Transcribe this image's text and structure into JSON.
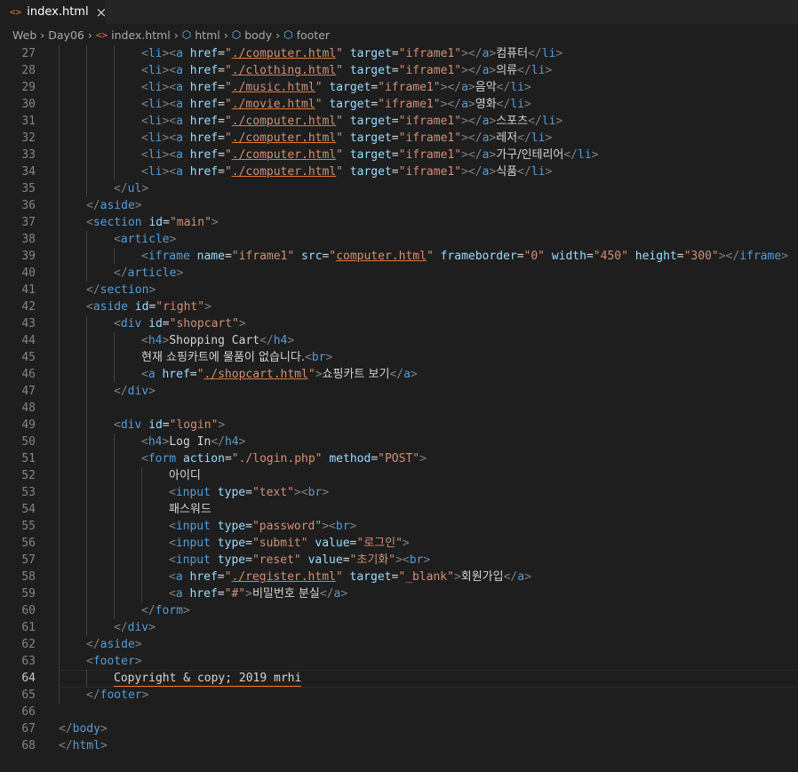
{
  "tab": {
    "label": "index.html",
    "icon": "html-file-icon"
  },
  "breadcrumb": {
    "items": [
      "Web",
      "Day06",
      "index.html",
      "html",
      "body",
      "footer"
    ]
  },
  "colors": {
    "tag": "#569cd6",
    "punct": "#808080",
    "attr": "#9cdcfe",
    "string": "#ce9178",
    "text": "#d4d4d4",
    "link_underline": "#e37933"
  },
  "code_lines": [
    {
      "n": "27",
      "indent": 3,
      "html": "<span class=\"p\">&lt;</span><span class=\"t\">li</span><span class=\"p\">&gt;&lt;</span><span class=\"t\">a</span> <span class=\"a\">href</span>=<span class=\"s\">\"<span class=\"u\">./computer.html</span>\"</span> <span class=\"a\">target</span>=<span class=\"s\">\"iframe1\"</span><span class=\"p\">&gt;&lt;/</span><span class=\"t\">a</span><span class=\"p\">&gt;</span><span class=\"ko\">컴퓨터</span><span class=\"p\">&lt;/</span><span class=\"t\">li</span><span class=\"p\">&gt;</span>"
    },
    {
      "n": "28",
      "indent": 3,
      "html": "<span class=\"p\">&lt;</span><span class=\"t\">li</span><span class=\"p\">&gt;&lt;</span><span class=\"t\">a</span> <span class=\"a\">href</span>=<span class=\"s\">\"<span class=\"u\">./clothing.html</span>\"</span> <span class=\"a\">target</span>=<span class=\"s\">\"iframe1\"</span><span class=\"p\">&gt;&lt;/</span><span class=\"t\">a</span><span class=\"p\">&gt;</span><span class=\"ko\">의류</span><span class=\"p\">&lt;/</span><span class=\"t\">li</span><span class=\"p\">&gt;</span>"
    },
    {
      "n": "29",
      "indent": 3,
      "html": "<span class=\"p\">&lt;</span><span class=\"t\">li</span><span class=\"p\">&gt;&lt;</span><span class=\"t\">a</span> <span class=\"a\">href</span>=<span class=\"s\">\"<span class=\"u\">./music.html</span>\"</span> <span class=\"a\">target</span>=<span class=\"s\">\"iframe1\"</span><span class=\"p\">&gt;&lt;/</span><span class=\"t\">a</span><span class=\"p\">&gt;</span><span class=\"ko\">음악</span><span class=\"p\">&lt;/</span><span class=\"t\">li</span><span class=\"p\">&gt;</span>"
    },
    {
      "n": "30",
      "indent": 3,
      "html": "<span class=\"p\">&lt;</span><span class=\"t\">li</span><span class=\"p\">&gt;&lt;</span><span class=\"t\">a</span> <span class=\"a\">href</span>=<span class=\"s\">\"<span class=\"u\">./movie.html</span>\"</span> <span class=\"a\">target</span>=<span class=\"s\">\"iframe1\"</span><span class=\"p\">&gt;&lt;/</span><span class=\"t\">a</span><span class=\"p\">&gt;</span><span class=\"ko\">영화</span><span class=\"p\">&lt;/</span><span class=\"t\">li</span><span class=\"p\">&gt;</span>"
    },
    {
      "n": "31",
      "indent": 3,
      "html": "<span class=\"p\">&lt;</span><span class=\"t\">li</span><span class=\"p\">&gt;&lt;</span><span class=\"t\">a</span> <span class=\"a\">href</span>=<span class=\"s\">\"<span class=\"u\">./computer.html</span>\"</span> <span class=\"a\">target</span>=<span class=\"s\">\"iframe1\"</span><span class=\"p\">&gt;&lt;/</span><span class=\"t\">a</span><span class=\"p\">&gt;</span><span class=\"ko\">스포츠</span><span class=\"p\">&lt;/</span><span class=\"t\">li</span><span class=\"p\">&gt;</span>"
    },
    {
      "n": "32",
      "indent": 3,
      "html": "<span class=\"p\">&lt;</span><span class=\"t\">li</span><span class=\"p\">&gt;&lt;</span><span class=\"t\">a</span> <span class=\"a\">href</span>=<span class=\"s\">\"<span class=\"u\">./computer.html</span>\"</span> <span class=\"a\">target</span>=<span class=\"s\">\"iframe1\"</span><span class=\"p\">&gt;&lt;/</span><span class=\"t\">a</span><span class=\"p\">&gt;</span><span class=\"ko\">레저</span><span class=\"p\">&lt;/</span><span class=\"t\">li</span><span class=\"p\">&gt;</span>"
    },
    {
      "n": "33",
      "indent": 3,
      "html": "<span class=\"p\">&lt;</span><span class=\"t\">li</span><span class=\"p\">&gt;&lt;</span><span class=\"t\">a</span> <span class=\"a\">href</span>=<span class=\"s\">\"<span class=\"u\">./computer.html</span>\"</span> <span class=\"a\">target</span>=<span class=\"s\">\"iframe1\"</span><span class=\"p\">&gt;&lt;/</span><span class=\"t\">a</span><span class=\"p\">&gt;</span><span class=\"ko\">가구/인테리어</span><span class=\"p\">&lt;/</span><span class=\"t\">li</span><span class=\"p\">&gt;</span>"
    },
    {
      "n": "34",
      "indent": 3,
      "html": "<span class=\"p\">&lt;</span><span class=\"t\">li</span><span class=\"p\">&gt;&lt;</span><span class=\"t\">a</span> <span class=\"a\">href</span>=<span class=\"s\">\"<span class=\"u\">./computer.html</span>\"</span> <span class=\"a\">target</span>=<span class=\"s\">\"iframe1\"</span><span class=\"p\">&gt;&lt;/</span><span class=\"t\">a</span><span class=\"p\">&gt;</span><span class=\"ko\">식품</span><span class=\"p\">&lt;/</span><span class=\"t\">li</span><span class=\"p\">&gt;</span>"
    },
    {
      "n": "35",
      "indent": 2,
      "html": "<span class=\"p\">&lt;/</span><span class=\"t\">ul</span><span class=\"p\">&gt;</span>"
    },
    {
      "n": "36",
      "indent": 1,
      "html": "<span class=\"p\">&lt;/</span><span class=\"t\">aside</span><span class=\"p\">&gt;</span>"
    },
    {
      "n": "37",
      "indent": 1,
      "html": "<span class=\"p\">&lt;</span><span class=\"t\">section</span> <span class=\"a\">id</span>=<span class=\"s\">\"main\"</span><span class=\"p\">&gt;</span>"
    },
    {
      "n": "38",
      "indent": 2,
      "html": "<span class=\"p\">&lt;</span><span class=\"t\">article</span><span class=\"p\">&gt;</span>"
    },
    {
      "n": "39",
      "indent": 3,
      "html": "<span class=\"p\">&lt;</span><span class=\"t\">iframe</span> <span class=\"a\">name</span>=<span class=\"s\">\"iframe1\"</span> <span class=\"a\">src</span>=<span class=\"s\">\"<span class=\"u\">computer.html</span>\"</span> <span class=\"a\">frameborder</span>=<span class=\"s\">\"0\"</span> <span class=\"a\">width</span>=<span class=\"s\">\"450\"</span> <span class=\"a\">height</span>=<span class=\"s\">\"300\"</span><span class=\"p\">&gt;&lt;/</span><span class=\"t\">iframe</span><span class=\"p\">&gt;</span>"
    },
    {
      "n": "40",
      "indent": 2,
      "html": "<span class=\"p\">&lt;/</span><span class=\"t\">article</span><span class=\"p\">&gt;</span>"
    },
    {
      "n": "41",
      "indent": 1,
      "html": "<span class=\"p\">&lt;/</span><span class=\"t\">section</span><span class=\"p\">&gt;</span>"
    },
    {
      "n": "42",
      "indent": 1,
      "html": "<span class=\"p\">&lt;</span><span class=\"t\">aside</span> <span class=\"a\">id</span>=<span class=\"s\">\"right\"</span><span class=\"p\">&gt;</span>"
    },
    {
      "n": "43",
      "indent": 2,
      "html": "<span class=\"p\">&lt;</span><span class=\"t\">div</span> <span class=\"a\">id</span>=<span class=\"s\">\"shopcart\"</span><span class=\"p\">&gt;</span>"
    },
    {
      "n": "44",
      "indent": 3,
      "html": "<span class=\"p\">&lt;</span><span class=\"t\">h4</span><span class=\"p\">&gt;</span>Shopping Cart<span class=\"p\">&lt;/</span><span class=\"t\">h4</span><span class=\"p\">&gt;</span>"
    },
    {
      "n": "45",
      "indent": 3,
      "html": "<span class=\"ko\">현재 쇼핑카트에 물품이 없습니다.</span><span class=\"p\">&lt;</span><span class=\"t\">br</span><span class=\"p\">&gt;</span>"
    },
    {
      "n": "46",
      "indent": 3,
      "html": "<span class=\"p\">&lt;</span><span class=\"t\">a</span> <span class=\"a\">href</span>=<span class=\"s\">\"<span class=\"u\">./shopcart.html</span>\"</span><span class=\"p\">&gt;</span><span class=\"ko\">쇼핑카트 보기</span><span class=\"p\">&lt;/</span><span class=\"t\">a</span><span class=\"p\">&gt;</span>"
    },
    {
      "n": "47",
      "indent": 2,
      "html": "<span class=\"p\">&lt;/</span><span class=\"t\">div</span><span class=\"p\">&gt;</span>"
    },
    {
      "n": "48",
      "indent": 2,
      "html": ""
    },
    {
      "n": "49",
      "indent": 2,
      "html": "<span class=\"p\">&lt;</span><span class=\"t\">div</span> <span class=\"a\">id</span>=<span class=\"s\">\"login\"</span><span class=\"p\">&gt;</span>"
    },
    {
      "n": "50",
      "indent": 3,
      "html": "<span class=\"p\">&lt;</span><span class=\"t\">h4</span><span class=\"p\">&gt;</span>Log In<span class=\"p\">&lt;/</span><span class=\"t\">h4</span><span class=\"p\">&gt;</span>"
    },
    {
      "n": "51",
      "indent": 3,
      "html": "<span class=\"p\">&lt;</span><span class=\"t\">form</span> <span class=\"a\">action</span>=<span class=\"s\">\"./login.php\"</span> <span class=\"a\">method</span>=<span class=\"s\">\"POST\"</span><span class=\"p\">&gt;</span>"
    },
    {
      "n": "52",
      "indent": 4,
      "html": "<span class=\"ko\">아이디</span>"
    },
    {
      "n": "53",
      "indent": 4,
      "html": "<span class=\"p\">&lt;</span><span class=\"t\">input</span> <span class=\"a\">type</span>=<span class=\"s\">\"text\"</span><span class=\"p\">&gt;&lt;</span><span class=\"t\">br</span><span class=\"p\">&gt;</span>"
    },
    {
      "n": "54",
      "indent": 4,
      "html": "<span class=\"ko\">패스워드</span>"
    },
    {
      "n": "55",
      "indent": 4,
      "html": "<span class=\"p\">&lt;</span><span class=\"t\">input</span> <span class=\"a\">type</span>=<span class=\"s\">\"password\"</span><span class=\"p\">&gt;&lt;</span><span class=\"t\">br</span><span class=\"p\">&gt;</span>"
    },
    {
      "n": "56",
      "indent": 4,
      "html": "<span class=\"p\">&lt;</span><span class=\"t\">input</span> <span class=\"a\">type</span>=<span class=\"s\">\"submit\"</span> <span class=\"a\">value</span>=<span class=\"s\">\"<span class=\"ko\">로그인</span>\"</span><span class=\"p\">&gt;</span>"
    },
    {
      "n": "57",
      "indent": 4,
      "html": "<span class=\"p\">&lt;</span><span class=\"t\">input</span> <span class=\"a\">type</span>=<span class=\"s\">\"reset\"</span> <span class=\"a\">value</span>=<span class=\"s\">\"<span class=\"ko\">초기화</span>\"</span><span class=\"p\">&gt;&lt;</span><span class=\"t\">br</span><span class=\"p\">&gt;</span>"
    },
    {
      "n": "58",
      "indent": 4,
      "html": "<span class=\"p\">&lt;</span><span class=\"t\">a</span> <span class=\"a\">href</span>=<span class=\"s\">\"<span class=\"u\">./register.html</span>\"</span> <span class=\"a\">target</span>=<span class=\"s\">\"_blank\"</span><span class=\"p\">&gt;</span><span class=\"ko\">회원가입</span><span class=\"p\">&lt;/</span><span class=\"t\">a</span><span class=\"p\">&gt;</span>"
    },
    {
      "n": "59",
      "indent": 4,
      "html": "<span class=\"p\">&lt;</span><span class=\"t\">a</span> <span class=\"a\">href</span>=<span class=\"s\">\"#\"</span><span class=\"p\">&gt;</span><span class=\"ko\">비밀번호 분실</span><span class=\"p\">&lt;/</span><span class=\"t\">a</span><span class=\"p\">&gt;</span>"
    },
    {
      "n": "60",
      "indent": 3,
      "html": "<span class=\"p\">&lt;/</span><span class=\"t\">form</span><span class=\"p\">&gt;</span>"
    },
    {
      "n": "61",
      "indent": 2,
      "html": "<span class=\"p\">&lt;/</span><span class=\"t\">div</span><span class=\"p\">&gt;</span>"
    },
    {
      "n": "62",
      "indent": 1,
      "html": "<span class=\"p\">&lt;/</span><span class=\"t\">aside</span><span class=\"p\">&gt;</span>"
    },
    {
      "n": "63",
      "indent": 1,
      "html": "<span class=\"p\">&lt;</span><span class=\"t\">footer</span><span class=\"p\">&gt;</span>"
    },
    {
      "n": "64",
      "indent": 2,
      "current": true,
      "html": "<span class=\"k\" style=\"border-bottom:1px solid #e37933;padding-bottom:1px;\">Copyright &amp; copy; 2019 mrhi</span>"
    },
    {
      "n": "65",
      "indent": 1,
      "html": "<span class=\"p\">&lt;/</span><span class=\"t\">footer</span><span class=\"p\">&gt;</span>"
    },
    {
      "n": "66",
      "indent": 0,
      "html": ""
    },
    {
      "n": "67",
      "indent": 0,
      "html": "<span class=\"p\">&lt;/</span><span class=\"t\">body</span><span class=\"p\">&gt;</span>"
    },
    {
      "n": "68",
      "indent": 0,
      "html": "<span class=\"p\">&lt;/</span><span class=\"t\">html</span><span class=\"p\">&gt;</span>"
    }
  ]
}
